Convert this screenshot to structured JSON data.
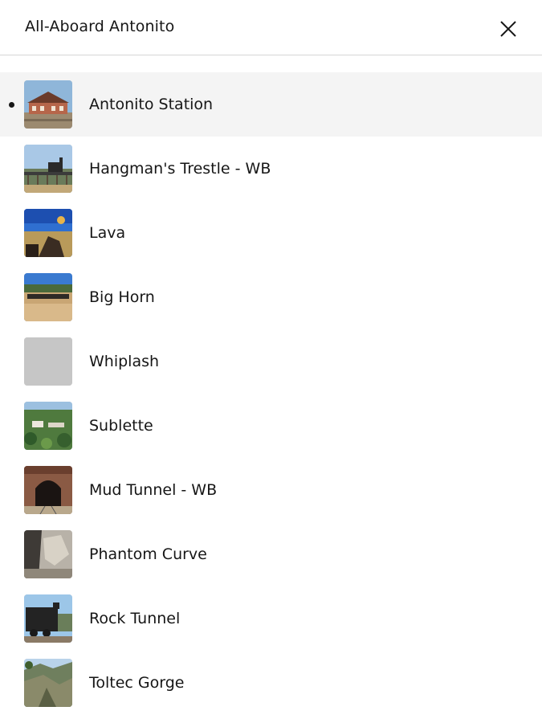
{
  "header": {
    "title": "All-Aboard Antonito",
    "close_icon": "close-icon"
  },
  "items": [
    {
      "label": "Antonito Station",
      "active": true,
      "thumbnail": "station-building-photo"
    },
    {
      "label": "Hangman's Trestle - WB",
      "active": false,
      "thumbnail": "train-on-trestle-photo"
    },
    {
      "label": "Lava",
      "active": false,
      "thumbnail": "lava-landscape-photo"
    },
    {
      "label": "Big Horn",
      "active": false,
      "thumbnail": "train-on-hillside-photo"
    },
    {
      "label": "Whiplash",
      "active": false,
      "thumbnail": "placeholder"
    },
    {
      "label": "Sublette",
      "active": false,
      "thumbnail": "forest-buildings-photo"
    },
    {
      "label": "Mud Tunnel - WB",
      "active": false,
      "thumbnail": "tunnel-photo"
    },
    {
      "label": "Phantom Curve",
      "active": false,
      "thumbnail": "rock-formation-photo"
    },
    {
      "label": "Rock Tunnel",
      "active": false,
      "thumbnail": "locomotive-photo"
    },
    {
      "label": "Toltec Gorge",
      "active": false,
      "thumbnail": "gorge-photo"
    }
  ]
}
